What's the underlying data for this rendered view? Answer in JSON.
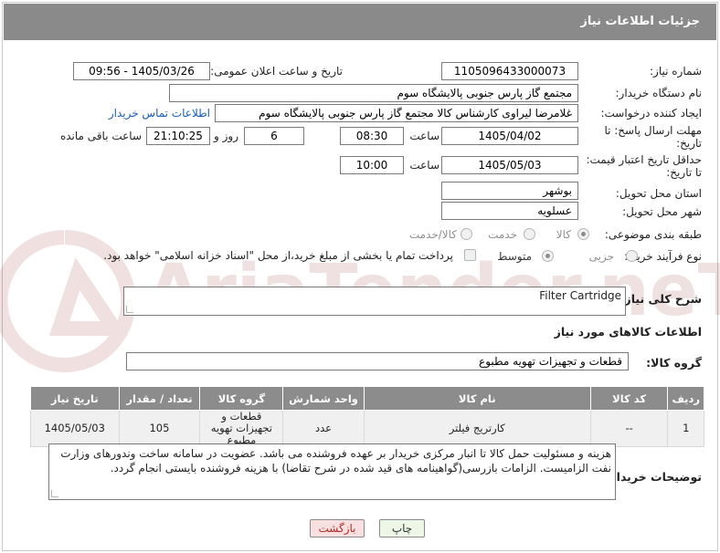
{
  "header": {
    "title": "جزئیات اطلاعات نیاز"
  },
  "fields": {
    "need_number_label": "شماره نیاز:",
    "need_number": "1105096433000073",
    "announce_label": "تاریخ و ساعت اعلان عمومی:",
    "announce_value": "1405/03/26 - 09:56",
    "buyer_org_label": "نام دستگاه خریدار:",
    "buyer_org": "مجتمع گاز پارس جنوبی  پالایشگاه سوم",
    "creator_label": "ایجاد کننده درخواست:",
    "creator": "غلامرضا لیراوی کارشناس کالا مجتمع گاز پارس جنوبی  پالایشگاه سوم",
    "contact_link": "اطلاعات تماس خریدار",
    "deadline_label_1": "مهلت ارسال پاسخ: تا",
    "deadline_label_2": "تاریخ:",
    "deadline_date": "1405/04/02",
    "time_label": "ساعت",
    "deadline_time": "08:30",
    "days": "6",
    "days_label": "روز و",
    "remaining_time": "21:10:25",
    "remaining_label": "ساعت باقی مانده",
    "validity_label_1": "حداقل تاریخ اعتبار قیمت:",
    "validity_label_2": "تا تاریخ:",
    "validity_date": "1405/05/03",
    "validity_time": "10:00",
    "province_label": "استان محل تحویل:",
    "province": "بوشهر",
    "city_label": "شهر محل تحویل:",
    "city": "عسلویه",
    "category_label": "طبقه بندی موضوعی:",
    "category_options": [
      "کالا",
      "خدمت",
      "کالا/خدمت"
    ],
    "process_label": "نوع فرآیند خرید :",
    "process_options": [
      "جزیی",
      "متوسط"
    ],
    "payment_note": "پرداخت تمام یا بخشی از مبلغ خرید،از محل \"اسناد خزانه اسلامی\" خواهد بود."
  },
  "description": {
    "label": "شرح کلی نیاز:",
    "value": "Filter Cartridge"
  },
  "goods": {
    "section_title": "اطلاعات کالاهای مورد نیاز",
    "group_label": "گروه کالا:",
    "group_value": "قطعات و تجهیزات تهویه مطبوع",
    "columns": [
      "ردیف",
      "کد کالا",
      "نام کالا",
      "واحد شمارش",
      "گروه کالا",
      "تعداد / مقدار",
      "تاریخ نیاز"
    ],
    "rows": [
      [
        "1",
        "--",
        "کارتریج فیلتر",
        "عدد",
        "قطعات و تجهیزات تهویه مطبوع",
        "105",
        "1405/05/03"
      ]
    ]
  },
  "buyer_notes": {
    "label": "توضیحات خریدار:",
    "value": "هزینه و مسئولیت حمل کالا تا انبار مرکزی خریدار بر عهده فروشنده می باشد. عضویت در سامانه ساخت وندورهای وزارت نفت الزامیست. الزامات بازرسی(گواهینامه های قید شده در شرح تقاضا) با هزینه فروشنده بایستی انجام گردد."
  },
  "buttons": {
    "print": "چاپ",
    "back": "بازگشت"
  },
  "watermark_text": "AriaTender.neT",
  "colors": {
    "header_bg": "#8a8a8a",
    "link": "#1a5fb4",
    "back_text": "#b02a2a"
  }
}
